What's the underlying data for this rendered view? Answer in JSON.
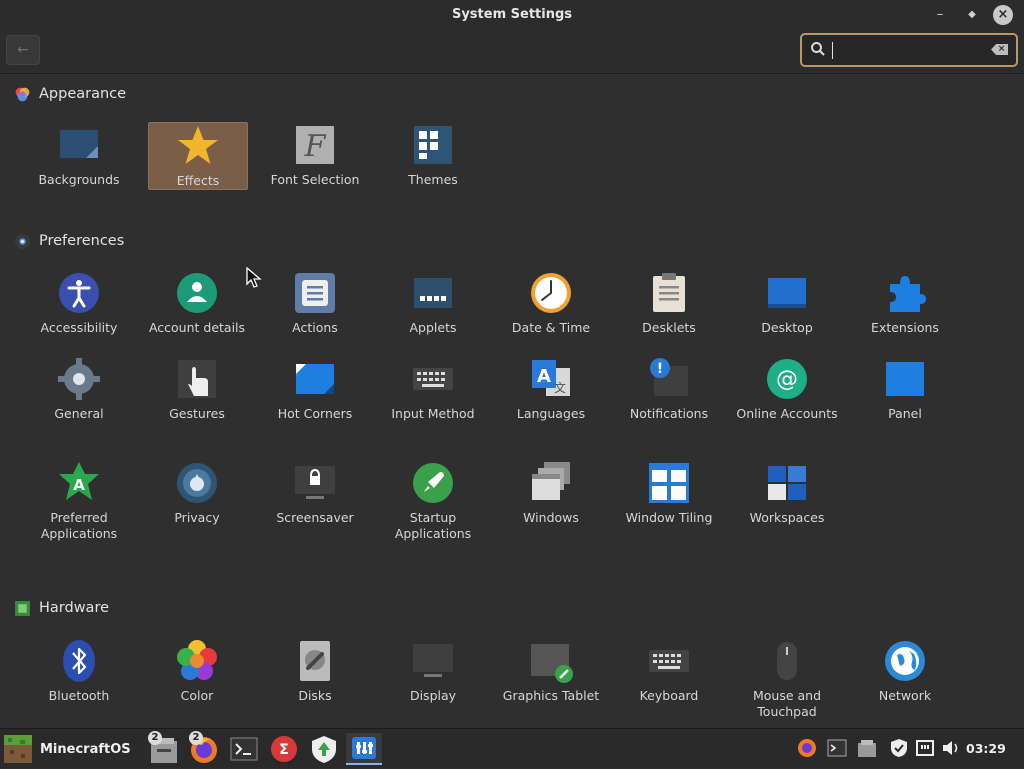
{
  "window": {
    "title": "System Settings"
  },
  "search": {
    "placeholder": "",
    "value": ""
  },
  "sections": {
    "appearance": {
      "title": "Appearance",
      "items": [
        "Backgrounds",
        "Effects",
        "Font Selection",
        "Themes"
      ]
    },
    "preferences": {
      "title": "Preferences",
      "items": [
        "Accessibility",
        "Account details",
        "Actions",
        "Applets",
        "Date & Time",
        "Desklets",
        "Desktop",
        "Extensions",
        "General",
        "Gestures",
        "Hot Corners",
        "Input Method",
        "Languages",
        "Notifications",
        "Online Accounts",
        "Panel",
        "Preferred Applications",
        "Privacy",
        "Screensaver",
        "Startup Applications",
        "Windows",
        "Window Tiling",
        "Workspaces"
      ]
    },
    "hardware": {
      "title": "Hardware",
      "items": [
        "Bluetooth",
        "Color",
        "Disks",
        "Display",
        "Graphics Tablet",
        "Keyboard",
        "Mouse and Touchpad",
        "Network"
      ]
    }
  },
  "taskbar": {
    "menu_label": "MinecraftOS",
    "files_badge": "2",
    "firefox_badge": "2",
    "clock": "03:29"
  },
  "colors": {
    "accent": "#b89868",
    "selected": "#7a5e48",
    "background": "#2f2f2f"
  }
}
